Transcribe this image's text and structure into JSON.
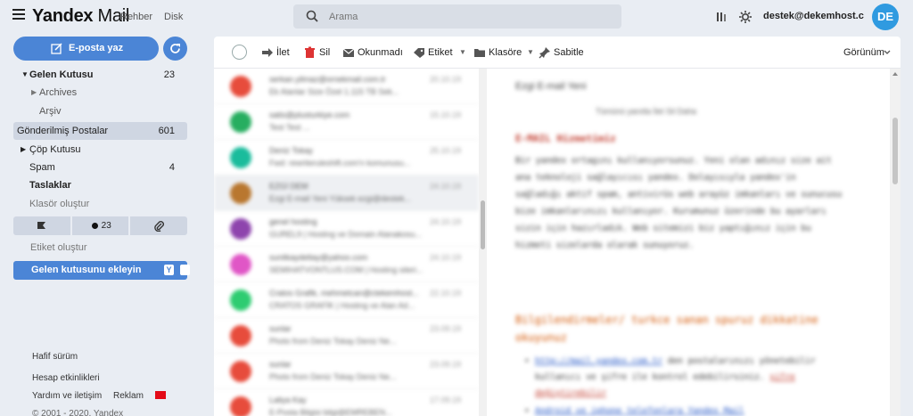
{
  "header": {
    "logo_brand": "Yandex",
    "logo_product": " Mail",
    "nav": [
      "Rehber",
      "Disk"
    ],
    "search_placeholder": "Arama",
    "user_email": "destek@dekemhost.c",
    "avatar_initials": "DE"
  },
  "sidebar": {
    "compose_label": "E-posta yaz",
    "folders": [
      {
        "name": "Gelen Kutusu",
        "count": "23"
      },
      {
        "name": "Archives",
        "count": ""
      },
      {
        "name": "Arşiv",
        "count": ""
      },
      {
        "name": "Gönderilmiş Postalar",
        "count": "601"
      },
      {
        "name": "Çöp Kutusu",
        "count": ""
      },
      {
        "name": "Spam",
        "count": "4"
      },
      {
        "name": "Taslaklar",
        "count": ""
      },
      {
        "name": "Klasör oluştur",
        "count": ""
      }
    ],
    "filter_unread_count": "23",
    "create_label": "Etiket oluştur",
    "add_inbox_label": "Gelen kutusunu ekleyin",
    "add_inbox_badge": "Y",
    "footer": {
      "light_version": "Hafif sürüm",
      "account_activity": "Hesap etkinlikleri",
      "help": "Yardım ve iletişim",
      "ads": "Reklam",
      "copyright": "© 2001 - 2020, Yandex"
    }
  },
  "toolbar": {
    "forward": "İlet",
    "delete": "Sil",
    "unread": "Okunmadı",
    "label": "Etiket",
    "folder": "Klasöre",
    "pin": "Sabitle",
    "view": "Görünüm"
  },
  "messages": [
    {
      "from": "serkan.yilmaz@ornekmail.com.tr",
      "subject": "Ek Alanlar Size Özel 1.115 TB Sek...",
      "date": "20.10.19",
      "color": "#e74c3c"
    },
    {
      "from": "satis@plusturkiye.com",
      "subject": "Test   Test ...",
      "date": "15.10.19",
      "color": "#27ae60"
    },
    {
      "from": "Deniz Tokay",
      "subject": "Fwd: rewriteruleshift.com'n komunusu...",
      "date": "25.10.19",
      "color": "#1abc9c"
    },
    {
      "from": "EZGİ DEM",
      "subject": "Ezgi E-mail Yeni   Yüksek ezgi@destek...",
      "date": "24.10.19",
      "color": "#b9772f"
    },
    {
      "from": "genel hosting",
      "subject": "GUREL9 | Hosting ve Domain Alanakosu...",
      "date": "24.10.19",
      "color": "#8e44ad"
    },
    {
      "from": "sunitkaydeltay@yahoo.com",
      "subject": "SEMIHATVONTLUS.COM | Hosting siteri...",
      "date": "24.10.19",
      "color": "#e056c6"
    },
    {
      "from": "Cratos Grafik, mehmetcan@ctekemhost...",
      "subject": "CRATOS GRAFİK | Hosting ve Alan Ad...",
      "date": "22.10.19",
      "color": "#2ecc71"
    },
    {
      "from": "sunlar",
      "subject": "Photo from Deniz Tokay   Deniz Ne...",
      "date": "23.09.19",
      "color": "#e74c3c"
    },
    {
      "from": "sunlar",
      "subject": "Photo from Deniz Tokay   Deniz Ne...",
      "date": "23.09.19",
      "color": "#e74c3c"
    },
    {
      "from": "Laliya Kay",
      "subject": "E-Posta Bilgisi   bilgi@EMREBEN...",
      "date": "17.09.19",
      "color": "#e74c3c"
    }
  ],
  "reader": {
    "subject": "Ezgi E-mail Yeni",
    "actions": "Tümünü yanıtla    İlet    Sil    Daha",
    "heading": "E-MAIL Hizmetimiz",
    "para1": "Bir yandex ortagını kullanıyorsunuz. Yeni olan adınız size ait ana teknoloji sağlayıcısı yandex. Dolayısıyla yandex'in sağladığı aktif spam, antivirüs web arayüz imkanları ve sunucusu bize imkanlarınızı kullanıyor. Kurumunuz üzerinde bu ayarları sizin için hazırladık. Web sitemizi biz yaptığınız için bu hizmeti sizelarda olarak sunuyoruz.",
    "heading2": "Bilgilendirmeler/ turkce sanan spuruz dikkatine okuyunuz",
    "li1_link": "http://mail.yandex.com.tr",
    "li1_text": " den postalarınızı yönetebilir kullanıcı ve şifre ile kontrol edebilirsiniz. ",
    "li1_red": "şifre değiştirebilir",
    "li2_text": "Android ve iphone telefonlara Yandex Mail"
  }
}
